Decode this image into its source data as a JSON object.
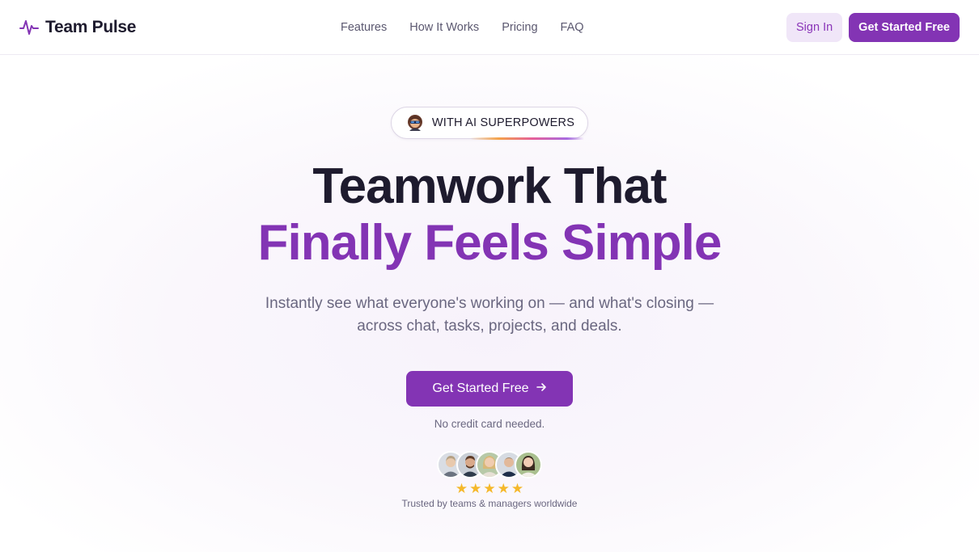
{
  "brand": {
    "name": "Team Pulse",
    "icon": "pulse-icon"
  },
  "nav": {
    "links": [
      "Features",
      "How It Works",
      "Pricing",
      "FAQ"
    ],
    "signin_label": "Sign In",
    "get_started_label": "Get Started Free"
  },
  "hero": {
    "badge_text": "WITH AI SUPERPOWERS",
    "headline_line1": "Teamwork That",
    "headline_line2": "Finally Feels Simple",
    "subheadline": "Instantly see what everyone's working on — and what's closing — across chat, tasks, projects, and deals.",
    "cta_label": "Get Started Free",
    "cta_icon": "arrow-right-icon",
    "cta_note": "No credit card needed.",
    "rating": 5,
    "trust_text": "Trusted by teams & managers worldwide"
  },
  "colors": {
    "accent": "#8334b4",
    "accent_light": "#f0e6f8",
    "text_dark": "#1e1b2e",
    "text_muted": "#6a6780",
    "star": "#f5b82a"
  }
}
